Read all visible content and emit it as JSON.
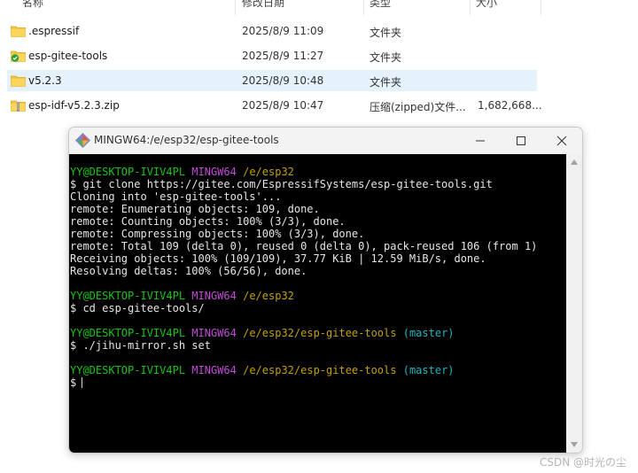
{
  "explorer": {
    "columns": [
      "名称",
      "修改日期",
      "类型",
      "大小"
    ],
    "rows": [
      {
        "name": ".espressif",
        "date": "2025/8/9 11:09",
        "type": "文件夹",
        "size": "",
        "icon": "folder-icon"
      },
      {
        "name": "esp-gitee-tools",
        "date": "2025/8/9 11:27",
        "type": "文件夹",
        "size": "",
        "icon": "folder-synced-icon"
      },
      {
        "name": "v5.2.3",
        "date": "2025/8/9 10:48",
        "type": "文件夹",
        "size": "",
        "icon": "folder-icon",
        "selected": true
      },
      {
        "name": "esp-idf-v5.2.3.zip",
        "date": "2025/8/9 10:47",
        "type": "压缩(zipped)文件...",
        "size": "1,682,668...",
        "icon": "zip-folder-icon"
      }
    ]
  },
  "terminal": {
    "title": "MINGW64:/e/esp32/esp-gitee-tools",
    "prompts": [
      {
        "user": "YY@DESKTOP-IVIV4PL",
        "host": "MINGW64",
        "path": "/e/esp32",
        "branch": ""
      },
      {
        "user": "YY@DESKTOP-IVIV4PL",
        "host": "MINGW64",
        "path": "/e/esp32",
        "branch": ""
      },
      {
        "user": "YY@DESKTOP-IVIV4PL",
        "host": "MINGW64",
        "path": "/e/esp32/esp-gitee-tools",
        "branch": "(master)"
      },
      {
        "user": "YY@DESKTOP-IVIV4PL",
        "host": "MINGW64",
        "path": "/e/esp32/esp-gitee-tools",
        "branch": "(master)"
      }
    ],
    "commands": [
      "$ git clone https://gitee.com/EspressifSystems/esp-gitee-tools.git",
      "$ cd esp-gitee-tools/",
      "$ ./jihu-mirror.sh set",
      "$"
    ],
    "output": [
      "Cloning into 'esp-gitee-tools'...",
      "remote: Enumerating objects: 109, done.",
      "remote: Counting objects: 100% (3/3), done.",
      "remote: Compressing objects: 100% (3/3), done.",
      "remote: Total 109 (delta 0), reused 0 (delta 0), pack-reused 106 (from 1)",
      "Receiving objects: 100% (109/109), 37.77 KiB | 12.59 MiB/s, done.",
      "Resolving deltas: 100% (56/56), done."
    ]
  },
  "watermark": "CSDN @时光の尘",
  "colors": {
    "prompt_user": "#13c613",
    "prompt_host": "#c24ad6",
    "prompt_path": "#c4a000",
    "prompt_branch": "#1db5c0",
    "selection": "#e5f1fb"
  }
}
